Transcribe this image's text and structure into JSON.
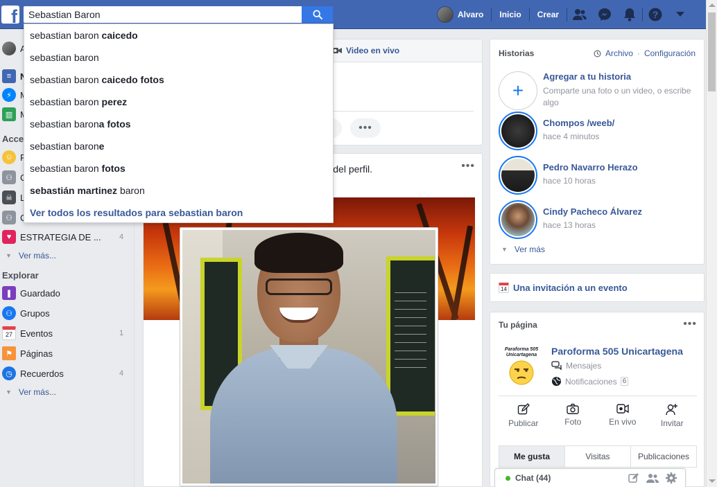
{
  "topbar": {
    "search_value": "Sebastian Baron",
    "user_name": "Alvaro",
    "nav_home": "Inicio",
    "nav_create": "Crear"
  },
  "search_suggestions": [
    {
      "prefix": "sebastian baron ",
      "bold": "caicedo",
      "suffix": ""
    },
    {
      "prefix": "sebastian baron",
      "bold": "",
      "suffix": ""
    },
    {
      "prefix": "sebastian baron ",
      "bold": "caicedo fotos",
      "suffix": ""
    },
    {
      "prefix": "sebastian baron ",
      "bold": "perez",
      "suffix": ""
    },
    {
      "prefix": "sebastian baron",
      "bold": "a fotos",
      "suffix": ""
    },
    {
      "prefix": "sebastian baron",
      "bold": "e",
      "suffix": ""
    },
    {
      "prefix": "sebastian baron ",
      "bold": "fotos",
      "suffix": ""
    },
    {
      "prefix": "",
      "bold": "sebastián martinez",
      "suffix": " baron"
    }
  ],
  "search_all": "Ver todos los resultados para sebastian baron",
  "left": {
    "row_a": "A",
    "row_n": "N",
    "row_m1": "M",
    "row_m2": "M",
    "accesos_heading": "Acce",
    "row_f": "F",
    "row_c1": "C",
    "row_l": "L",
    "row_c2": "C",
    "estrategia": "ESTRATEGIA DE ...",
    "estrategia_count": "4",
    "ver_mas_1": "Ver más...",
    "explorar_heading": "Explorar",
    "explorar": [
      {
        "label": "Guardado",
        "count": ""
      },
      {
        "label": "Grupos",
        "count": ""
      },
      {
        "label": "Eventos",
        "count": "1"
      },
      {
        "label": "Páginas",
        "count": ""
      },
      {
        "label": "Recuerdos",
        "count": "4"
      }
    ],
    "eventos_icon_day": "27",
    "ver_mas_2": "Ver más..."
  },
  "composer": {
    "live_label": "Video en vivo",
    "more_dots": "•••"
  },
  "post": {
    "text": "foto del perfil.",
    "menu_dots": "•••"
  },
  "stories": {
    "title": "Historias",
    "archive": "Archivo",
    "separator": "·",
    "settings": "Configuración",
    "add_title": "Agregar a tu historia",
    "add_sub": "Comparte una foto o un video, o escribe algo",
    "items": [
      {
        "name": "Chompos /weeb/",
        "time": "hace 4 minutos"
      },
      {
        "name": "Pedro Navarro Herazo",
        "time": "hace 10 horas"
      },
      {
        "name": "Cindy Pacheco Álvarez",
        "time": "hace 13 horas"
      }
    ],
    "ver_mas": "Ver más"
  },
  "event": {
    "label": "Una invitación a un evento",
    "icon_day": "14"
  },
  "your_page": {
    "title": "Tu página",
    "menu_dots": "•••",
    "name": "Paroforma 505 Unicartagena",
    "logo_text": "Paraforma 505 Unicartagena",
    "messages": "Mensajes",
    "notifications": "Notificaciones",
    "notifications_count": "6",
    "actions": [
      "Publicar",
      "Foto",
      "En vivo",
      "Invitar"
    ],
    "tabs": [
      "Me gusta",
      "Visitas",
      "Publicaciones"
    ]
  },
  "chat": {
    "label": "Chat (44)"
  },
  "colors": {
    "brand_blue": "#4267b2",
    "link_blue": "#385898",
    "search_button": "#3578e5",
    "online_green": "#42b72a"
  }
}
